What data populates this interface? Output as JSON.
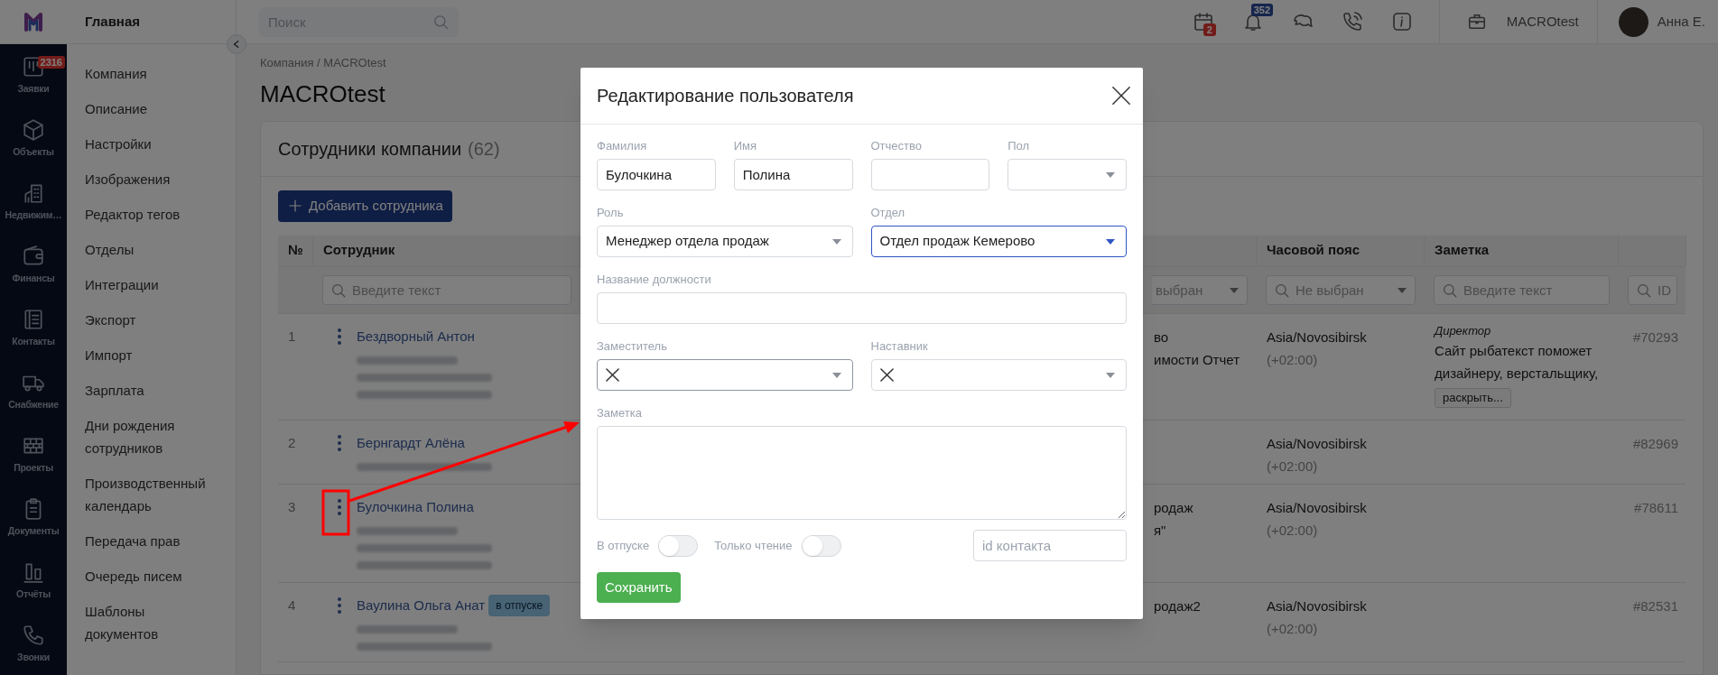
{
  "rail": {
    "items": [
      {
        "label": "Заявки",
        "badge": "2316"
      },
      {
        "label": "Объекты"
      },
      {
        "label": "Недвижим…"
      },
      {
        "label": "Финансы"
      },
      {
        "label": "Контакты"
      },
      {
        "label": "Снабжение"
      },
      {
        "label": "Проекты"
      },
      {
        "label": "Документы"
      },
      {
        "label": "Отчёты"
      },
      {
        "label": "Звонки"
      }
    ]
  },
  "nav": {
    "title": "Главная",
    "items": [
      "Компания",
      "Описание",
      "Настройки",
      "Изображения",
      "Редактор тегов",
      "Отделы",
      "Интеграции",
      "Экспорт",
      "Импорт",
      "Зарплата",
      "Дни рождения сотрудников",
      "Производственный календарь",
      "Передача прав",
      "Очередь писем",
      "Шаблоны документов"
    ]
  },
  "topbar": {
    "search_placeholder": "Поиск",
    "calendar_badge": "2",
    "notifications_badge": "352",
    "company": "MACROtest",
    "user": "Анна Е."
  },
  "breadcrumb": "Компания / MACROtest",
  "page_title": "MACROtest",
  "card": {
    "title": "Сотрудники компании",
    "count": "(62)",
    "add_button": "Добавить сотрудника"
  },
  "table": {
    "columns": [
      {
        "kind": "number",
        "label": "№"
      },
      {
        "kind": "employee",
        "label": "Сотрудник",
        "filter": {
          "kind": "search",
          "placeholder": "Введите текст"
        }
      },
      {
        "kind": "column_3",
        "filter": {
          "kind": "select_fragment",
          "placeholder": "выбран"
        }
      },
      {
        "kind": "timezone",
        "label": "Часовой пояс",
        "filter": {
          "kind": "select",
          "placeholder": "Не выбран"
        }
      },
      {
        "kind": "note",
        "label": "Заметка",
        "filter": {
          "kind": "search",
          "placeholder": "Введите текст"
        }
      },
      {
        "kind": "id",
        "filter": {
          "kind": "search",
          "placeholder": "ID"
        }
      }
    ],
    "rows": [
      {
        "number": "1",
        "name": "Бездворный Антон",
        "blurred": [
          {
            "kind": "phone"
          },
          {
            "kind": "email"
          },
          {
            "kind": "email"
          }
        ],
        "column_3": [
          "во",
          "имости Отчет"
        ],
        "timezone": "Asia/Novosibirsk",
        "offset": "(+02:00)",
        "note": {
          "title": "Директор",
          "text": "Сайт рыбатекст поможет дизайнеру, верстальщику,",
          "more": "раскрыть..."
        },
        "id": "#70293",
        "highlighted": false
      },
      {
        "number": "2",
        "name": "Бернгардт Алёна",
        "blurred": [
          {
            "kind": "email"
          }
        ],
        "timezone": "Asia/Novosibirsk",
        "offset": "(+02:00)",
        "id": "#82969",
        "highlighted": false
      },
      {
        "number": "3",
        "name": "Булочкина Полина",
        "blurred": [
          {
            "kind": "phone"
          },
          {
            "kind": "email"
          },
          {
            "kind": "email"
          }
        ],
        "column_3": [
          "родаж",
          "я\""
        ],
        "timezone": "Asia/Novosibirsk",
        "offset": "(+02:00)",
        "id": "#78611",
        "highlighted": true
      },
      {
        "number": "4",
        "name": "Ваулина Ольга Анат",
        "tag": "в отпуске",
        "blurred": [
          {
            "kind": "phone"
          },
          {
            "kind": "email"
          }
        ],
        "column_3": [
          "родаж2"
        ],
        "timezone": "Asia/Novosibirsk",
        "offset": "(+02:00)",
        "id": "#82531",
        "highlighted": false
      }
    ]
  },
  "modal": {
    "title": "Редактирование пользователя",
    "fields": [
      {
        "kind": "text",
        "label": "Фамилия",
        "value": "Булочкина",
        "focused": false,
        "hovered": false
      },
      {
        "kind": "text",
        "label": "Имя",
        "value": "Полина",
        "focused": false,
        "hovered": false
      },
      {
        "kind": "text",
        "label": "Отчество",
        "focused": false,
        "hovered": false
      },
      {
        "kind": "select",
        "label": "Пол",
        "focused": false,
        "hovered": false
      },
      {
        "kind": "select",
        "label": "Роль",
        "value": "Менеджер отдела продаж",
        "focused": false,
        "hovered": false
      },
      {
        "kind": "select",
        "label": "Отдел",
        "value": "Отдел продаж Кемерово",
        "focused": true,
        "hovered": false
      },
      {
        "kind": "text",
        "label": "Название должности",
        "focused": false,
        "hovered": false
      },
      {
        "kind": "clearable_select",
        "label": "Заместитель",
        "focused": false,
        "hovered": true
      },
      {
        "kind": "clearable_select",
        "label": "Наставник",
        "focused": false,
        "hovered": false
      },
      {
        "kind": "textarea",
        "label": "Заметка",
        "focused": false,
        "hovered": false
      }
    ],
    "toggles": [
      {
        "label": "В отпуске",
        "on": false
      },
      {
        "label": "Только чтение",
        "on": false
      }
    ],
    "contact_id": {
      "placeholder": "id контакта"
    },
    "save_button": "Сохранить"
  }
}
